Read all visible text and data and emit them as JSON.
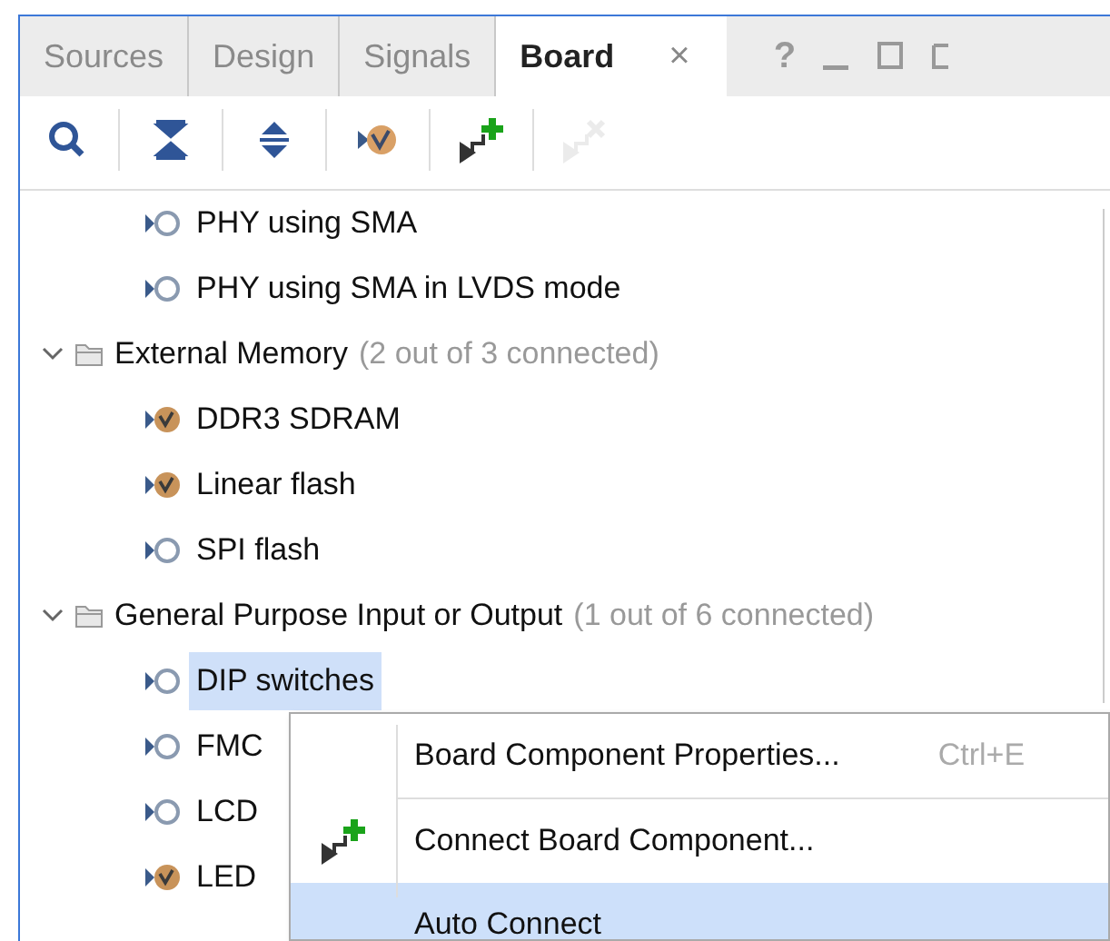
{
  "tabs": [
    {
      "label": "Sources",
      "selected": false
    },
    {
      "label": "Design",
      "selected": false
    },
    {
      "label": "Signals",
      "selected": false
    },
    {
      "label": "Board",
      "selected": true,
      "close": "×"
    }
  ],
  "window_controls": [
    "?"
  ],
  "toolbar": [
    {
      "kind": "search",
      "disabled": false
    },
    {
      "kind": "collapse",
      "disabled": false
    },
    {
      "kind": "expand",
      "disabled": false
    },
    {
      "kind": "auto",
      "disabled": false
    },
    {
      "kind": "connect",
      "disabled": false
    },
    {
      "kind": "disconnect",
      "disabled": true
    }
  ],
  "tree": [
    {
      "kind": "component",
      "label": "PHY using SMA",
      "connected": false,
      "selected": false
    },
    {
      "kind": "component",
      "label": "PHY using SMA in LVDS mode",
      "connected": false,
      "selected": false
    },
    {
      "kind": "group",
      "label": "External Memory",
      "count": "(2 out of 3 connected)",
      "expanded": true,
      "children": [
        {
          "kind": "component",
          "label": "DDR3 SDRAM",
          "connected": true,
          "selected": false
        },
        {
          "kind": "component",
          "label": "Linear flash",
          "connected": true,
          "selected": false
        },
        {
          "kind": "component",
          "label": "SPI flash",
          "connected": false,
          "selected": false
        }
      ]
    },
    {
      "kind": "group",
      "label": "General Purpose Input or Output",
      "count": "(1 out of 6 connected)",
      "expanded": true,
      "children": [
        {
          "kind": "component",
          "label": "DIP switches",
          "connected": false,
          "selected": true
        },
        {
          "kind": "component",
          "label": "FMC",
          "connected": false,
          "selected": false
        },
        {
          "kind": "component",
          "label": "LCD",
          "connected": false,
          "selected": false
        },
        {
          "kind": "component",
          "label": "LED",
          "connected": true,
          "selected": false
        }
      ]
    }
  ],
  "context_menu": [
    {
      "label": "Board Component Properties...",
      "shortcut": "Ctrl+E",
      "kind": "plain",
      "selected": false
    },
    {
      "label": "Connect Board Component...",
      "kind": "connect",
      "selected": false
    },
    {
      "label": "Auto Connect",
      "kind": "plain",
      "selected": true
    }
  ]
}
